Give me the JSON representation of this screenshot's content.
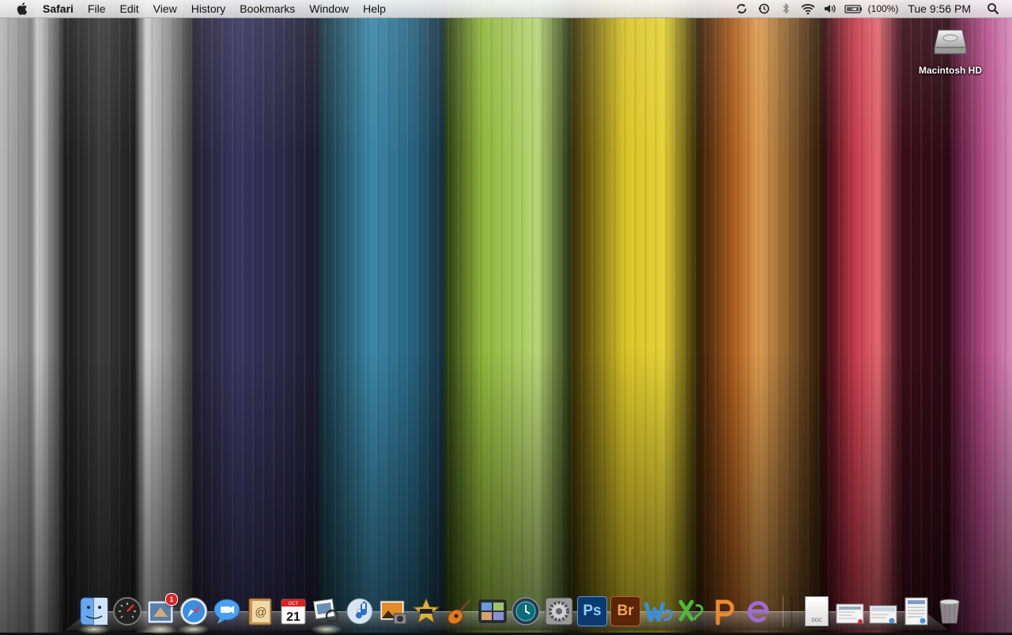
{
  "menubar": {
    "app_name": "Safari",
    "menus": [
      "File",
      "Edit",
      "View",
      "History",
      "Bookmarks",
      "Window",
      "Help"
    ],
    "status": {
      "battery_text": "(100%)",
      "clock": "Tue 9:56 PM",
      "icons": [
        "sync-icon",
        "time-machine-icon",
        "bluetooth-icon",
        "wifi-icon",
        "volume-icon",
        "battery-icon",
        "spotlight-icon"
      ]
    }
  },
  "desktop": {
    "drive_label": "Macintosh HD"
  },
  "dock": {
    "apps": [
      {
        "name": "Finder",
        "running": true
      },
      {
        "name": "Dashboard",
        "running": false
      },
      {
        "name": "Mail",
        "running": true,
        "badge": "1"
      },
      {
        "name": "Safari",
        "running": true
      },
      {
        "name": "iChat",
        "running": false
      },
      {
        "name": "Address Book",
        "running": false
      },
      {
        "name": "iCal",
        "running": false,
        "date_month": "OCT",
        "date_day": "21"
      },
      {
        "name": "Preview",
        "running": true
      },
      {
        "name": "iTunes",
        "running": false
      },
      {
        "name": "iPhoto",
        "running": false
      },
      {
        "name": "iMovie",
        "running": false
      },
      {
        "name": "GarageBand",
        "running": false
      },
      {
        "name": "Spaces",
        "running": false
      },
      {
        "name": "Time Machine",
        "running": false
      },
      {
        "name": "System Preferences",
        "running": false
      },
      {
        "name": "Photoshop",
        "label": "Ps",
        "running": false
      },
      {
        "name": "Bridge",
        "label": "Br",
        "running": false
      },
      {
        "name": "Word",
        "running": false
      },
      {
        "name": "Excel",
        "running": false
      },
      {
        "name": "PowerPoint",
        "running": false
      },
      {
        "name": "Entourage",
        "running": false
      }
    ],
    "stacks": [
      {
        "name": "Documents",
        "label": "DOC"
      },
      {
        "name": "Downloads"
      },
      {
        "name": "Pictures"
      },
      {
        "name": "Applications"
      },
      {
        "name": "Trash"
      }
    ]
  }
}
